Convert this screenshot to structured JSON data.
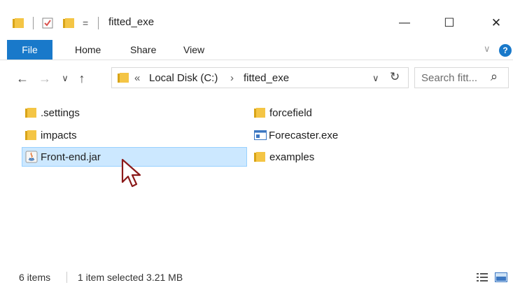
{
  "window": {
    "title": "fitted_exe",
    "qa_dropdown": "=",
    "minimize": "—",
    "maximize": "☐",
    "close": "✕"
  },
  "ribbon": {
    "tabs": [
      "File",
      "Home",
      "Share",
      "View"
    ],
    "help": "?",
    "collapse": "∨",
    "accent": "#1979ca"
  },
  "address": {
    "back": "←",
    "forward": "→",
    "recent": "∨",
    "up": "↑",
    "overflow": "«",
    "crumbs": [
      "Local Disk (C:)",
      "fitted_exe"
    ],
    "crumb_sep": "›",
    "dropdown": "∨",
    "refresh": "↻"
  },
  "search": {
    "placeholder": "Search fitt...",
    "icon": "⌕"
  },
  "files": [
    {
      "name": ".settings",
      "icon": "folder-icon"
    },
    {
      "name": "impacts",
      "icon": "folder-icon"
    },
    {
      "name": "Front-end.jar",
      "icon": "java-jar-icon",
      "selected": true
    },
    {
      "name": "forcefield",
      "icon": "folder-icon"
    },
    {
      "name": "Forecaster.exe",
      "icon": "exe-window-icon"
    },
    {
      "name": "examples",
      "icon": "folder-icon"
    }
  ],
  "status": {
    "count": "6 items",
    "selection": "1 item selected  3.21 MB"
  },
  "colors": {
    "selection_bg": "#cce8ff",
    "selection_border": "#99d1ff",
    "folder": "#f4c545"
  }
}
